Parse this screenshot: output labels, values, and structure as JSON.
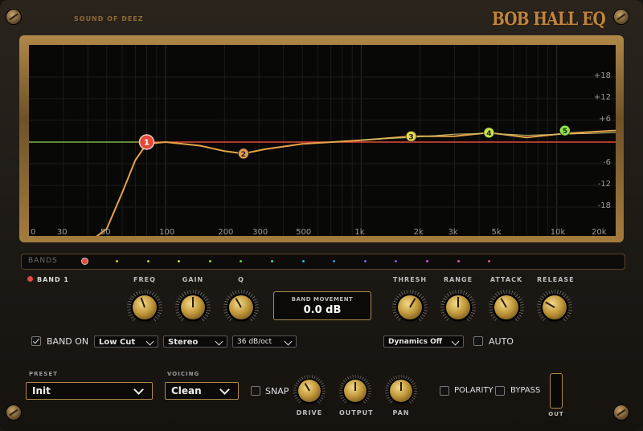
{
  "brand": "SOUND OF DEEZ",
  "logo": "BOB HALL EQ",
  "graph": {
    "freq_labels": [
      "0",
      "30",
      "50",
      "100",
      "200",
      "300",
      "500",
      "1k",
      "2k",
      "3k",
      "5k",
      "10k",
      "20k"
    ],
    "db_labels": [
      "+18",
      "+12",
      "+6",
      "-6",
      "-12",
      "-18"
    ],
    "nodes": [
      {
        "label": "1",
        "color": "#e2493a",
        "fq": 80
      },
      {
        "label": "2",
        "color": "#e69a4a",
        "fq": 250
      },
      {
        "label": "3",
        "color": "#e6d84a",
        "fq": 1800
      },
      {
        "label": "4",
        "color": "#c4e64a",
        "fq": 4500
      },
      {
        "label": "5",
        "color": "#8ee64a",
        "fq": 11000
      }
    ]
  },
  "bands_label": "BANDS",
  "band_dot_colors": [
    "#d4c23c",
    "#d4c23c",
    "#b8d43c",
    "#8ed43c",
    "#5ad43c",
    "#3cd48e",
    "#3cb8d4",
    "#3c8ed4",
    "#5a6ad4",
    "#8a5ad4",
    "#b85ad4",
    "#d45ab8",
    "#d45a8a"
  ],
  "band_selected": "BAND 1",
  "knobs": {
    "freq": "FREQ",
    "gain": "GAIN",
    "q": "Q",
    "thresh": "THRESH",
    "range": "RANGE",
    "attack": "ATTACK",
    "release": "RELEASE",
    "drive": "DRIVE",
    "output": "OUTPUT",
    "pan": "PAN"
  },
  "band_movement": {
    "title": "BAND MOVEMENT",
    "value": "0.0 dB"
  },
  "band_on": "BAND ON",
  "filter_type": "Low Cut",
  "stereo_mode": "Stereo",
  "slope": "36 dB/oct",
  "dynamics": "Dynamics Off",
  "auto": "AUTO",
  "preset_label": "PRESET",
  "preset_value": "Init",
  "voicing_label": "VOICING",
  "voicing_value": "Clean",
  "snap": "SNAP",
  "polarity": "POLARITY",
  "bypass": "BYPASS",
  "out": "OUT"
}
